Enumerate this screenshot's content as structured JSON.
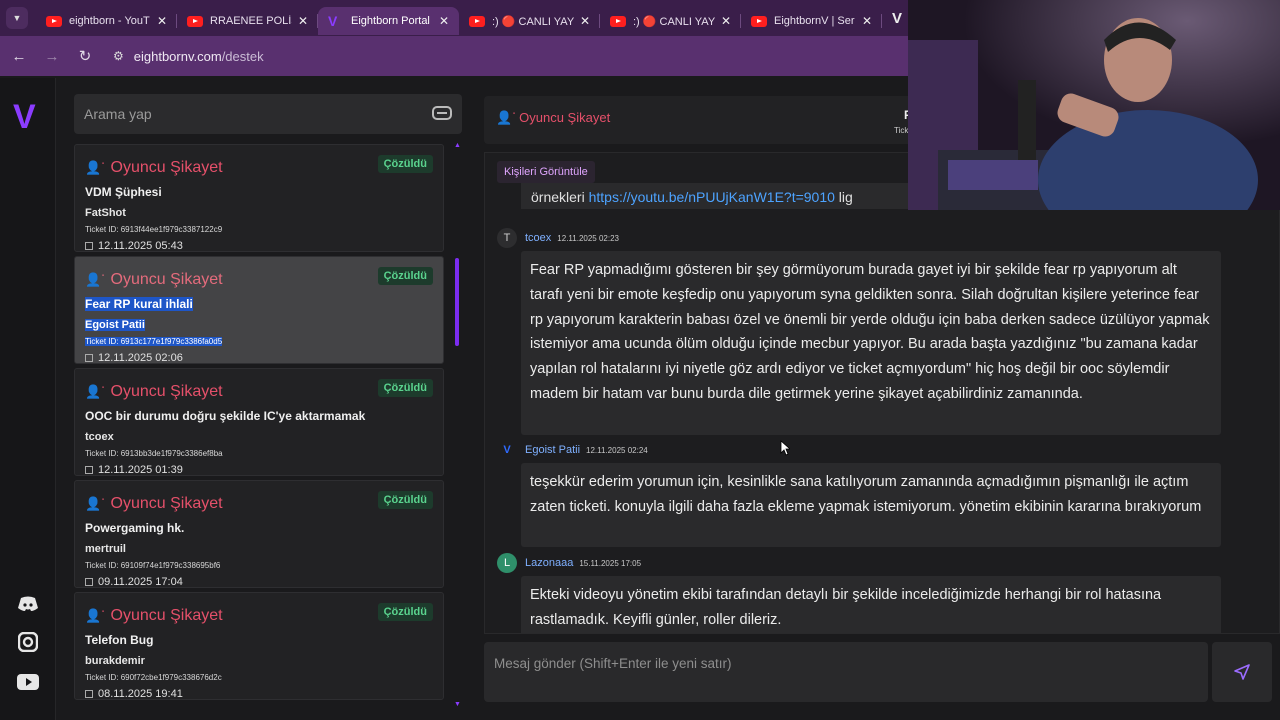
{
  "browser": {
    "tabs": [
      {
        "label": "eightborn - YouT",
        "kind": "youtube",
        "active": false
      },
      {
        "label": "RRAENEE POLİS",
        "kind": "youtube",
        "active": false
      },
      {
        "label": "Eightborn Portal",
        "kind": "site",
        "active": true
      },
      {
        "label": ":) 🔴 CANLI YAYI",
        "kind": "youtube",
        "active": false
      },
      {
        "label": ":) 🔴 CANLI YAYI",
        "kind": "youtube",
        "active": false
      },
      {
        "label": "EightbornV | Ser",
        "kind": "youtube",
        "active": false
      }
    ],
    "url_host": "eightbornv.com",
    "url_path": "/destek"
  },
  "sidebar": {
    "icons": [
      "discord-icon",
      "instagram-icon",
      "youtube-icon"
    ]
  },
  "list": {
    "search_placeholder": "Arama yap",
    "tickets": [
      {
        "category": "Oyuncu Şikayet",
        "status": "Çözüldü",
        "subject": "VDM Şüphesi",
        "user": "FatShot",
        "ticket_id": "Ticket ID: 6913f44ee1f979c3387122c9",
        "date": "12.11.2025 05:43",
        "selected": false
      },
      {
        "category": "Oyuncu Şikayet",
        "status": "Çözüldü",
        "subject": "Fear RP kural ihlali",
        "user": "Egoist Patii",
        "ticket_id": "Ticket ID: 6913c177e1f979c3386fa0d5",
        "date": "12.11.2025 02:06",
        "selected": true
      },
      {
        "category": "Oyuncu Şikayet",
        "status": "Çözüldü",
        "subject": "OOC bir durumu doğru şekilde IC'ye aktarmamak",
        "user": "tcoex",
        "ticket_id": "Ticket ID: 6913bb3de1f979c3386ef8ba",
        "date": "12.11.2025 01:39",
        "selected": false
      },
      {
        "category": "Oyuncu Şikayet",
        "status": "Çözüldü",
        "subject": "Powergaming hk.",
        "user": "mertruil",
        "ticket_id": "Ticket ID: 69109f74e1f979c338695bf6",
        "date": "09.11.2025 17:04",
        "selected": false
      },
      {
        "category": "Oyuncu Şikayet",
        "status": "Çözüldü",
        "subject": "Telefon Bug",
        "user": "burakdemir",
        "ticket_id": "Ticket ID: 690f72cbe1f979c338676d2c",
        "date": "08.11.2025 19:41",
        "selected": false
      }
    ]
  },
  "chat": {
    "header_category": "Oyuncu Şikayet",
    "header_right_title": "Fe",
    "header_right_sub": "Ticket",
    "view_people_label": "Kişileri Görüntüle",
    "fragment_text": "örnekleri ",
    "fragment_link": "https://youtu.be/nPUUjKanW1E?t=9010",
    "fragment_tail": " lig",
    "messages": [
      {
        "avatar": "T",
        "author": "tcoex",
        "time": "12.11.2025 02:23",
        "text": "Fear RP yapmadığımı gösteren bir şey görmüyorum burada gayet iyi bir şekilde fear rp yapıyorum alt tarafı yeni bir emote keşfedip onu yapıyorum syna geldikten sonra. Silah doğrultan kişilere yeterince fear rp yapıyorum karakterin babası özel ve önemli bir yerde olduğu için baba derken sadece üzülüyor yapmak istemiyor ama ucunda ölüm olduğu içinde mecbur yapıyor. Bu arada başta yazdığınız \"bu zamana kadar yapılan rol hatalarını iyi niyetle göz ardı ediyor ve ticket açmıyordum\" hiç hoş değil bir ooc söylemdir madem bir hatam var bunu burda dile getirmek yerine şikayet açabilirdiniz zamanında."
      },
      {
        "avatar": "V",
        "author": "Egoist Patii",
        "time": "12.11.2025 02:24",
        "text": "teşekkür ederim yorumun için, kesinlikle sana katılıyorum zamanında açmadığımın pişmanlığı ile açtım zaten ticketi. konuyla ilgili daha fazla ekleme yapmak istemiyorum. yönetim ekibinin kararına bırakıyorum"
      },
      {
        "avatar": "L",
        "author": "Lazonaaa",
        "time": "15.11.2025 17:05",
        "text": "Ekteki videoyu yönetim ekibi tarafından detaylı bir şekilde incelediğimizde herhangi bir rol hatasına rastlamadık. Keyifli günler, roller dileriz."
      }
    ],
    "composer_placeholder": "Mesaj gönder (Shift+Enter ile yeni satır)"
  },
  "colors": {
    "accent": "#8b3cff",
    "category": "#e5506a",
    "status_bg": "#1d3b2c",
    "status_fg": "#5ad38e",
    "author": "#7fb0ff"
  }
}
